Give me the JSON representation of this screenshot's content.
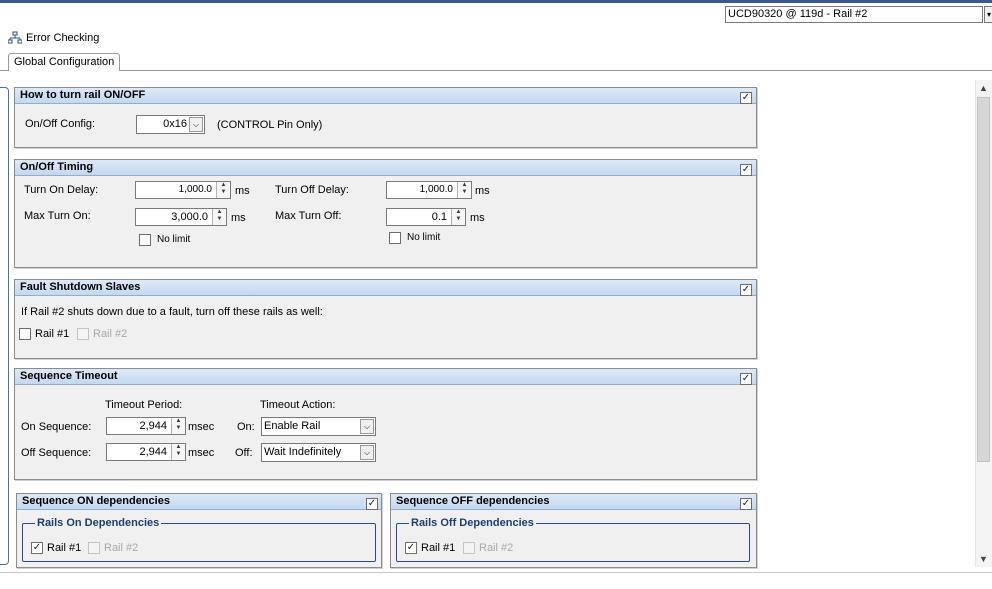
{
  "header": {
    "device_selector": "UCD90320 @ 119d - Rail #2",
    "dropdown_arrow": "▾"
  },
  "toolbar": {
    "error_checking_label": "Error Checking",
    "error_checking_icon": "network-tree-icon"
  },
  "tabs": [
    {
      "label": "Global Configuration"
    }
  ],
  "panels": {
    "onoff": {
      "title": "How to turn rail ON/OFF",
      "config_label": "On/Off Config:",
      "config_value": "0x16",
      "config_desc": "(CONTROL Pin Only)"
    },
    "timing": {
      "title": "On/Off Timing",
      "turn_on_delay_label": "Turn On Delay:",
      "turn_on_delay_value": "1,000.0",
      "turn_off_delay_label": "Turn Off Delay:",
      "turn_off_delay_value": "1,000.0",
      "max_turn_on_label": "Max Turn On:",
      "max_turn_on_value": "3,000.0",
      "max_turn_off_label": "Max Turn Off:",
      "max_turn_off_value": "0.1",
      "unit": "ms",
      "no_limit_label": "No limit"
    },
    "fault": {
      "title": "Fault Shutdown Slaves",
      "description": "If Rail #2 shuts down due to a fault, turn off these rails as well:",
      "rail1": "Rail #1",
      "rail2": "Rail #2"
    },
    "timeout": {
      "title": "Sequence Timeout",
      "period_header": "Timeout Period:",
      "action_header": "Timeout Action:",
      "on_seq_label": "On Sequence:",
      "on_seq_value": "2,944",
      "off_seq_label": "Off Sequence:",
      "off_seq_value": "2,944",
      "unit": "msec",
      "on_label": "On:",
      "on_action": "Enable Rail",
      "off_label": "Off:",
      "off_action": "Wait Indefinitely"
    },
    "seq_on": {
      "title": "Sequence ON dependencies",
      "group_title": "Rails On Dependencies",
      "rail1": "Rail #1",
      "rail2": "Rail #2"
    },
    "seq_off": {
      "title": "Sequence OFF dependencies",
      "group_title": "Rails Off Dependencies",
      "rail1": "Rail #1",
      "rail2": "Rail #2"
    }
  },
  "glyphs": {
    "check": "✓",
    "up": "▲",
    "down": "▼",
    "combo": "⌵"
  },
  "colors": {
    "panel_header": "#c5d8ef",
    "group_border": "#2a4e84",
    "top_bar": "#3a5a8c"
  }
}
